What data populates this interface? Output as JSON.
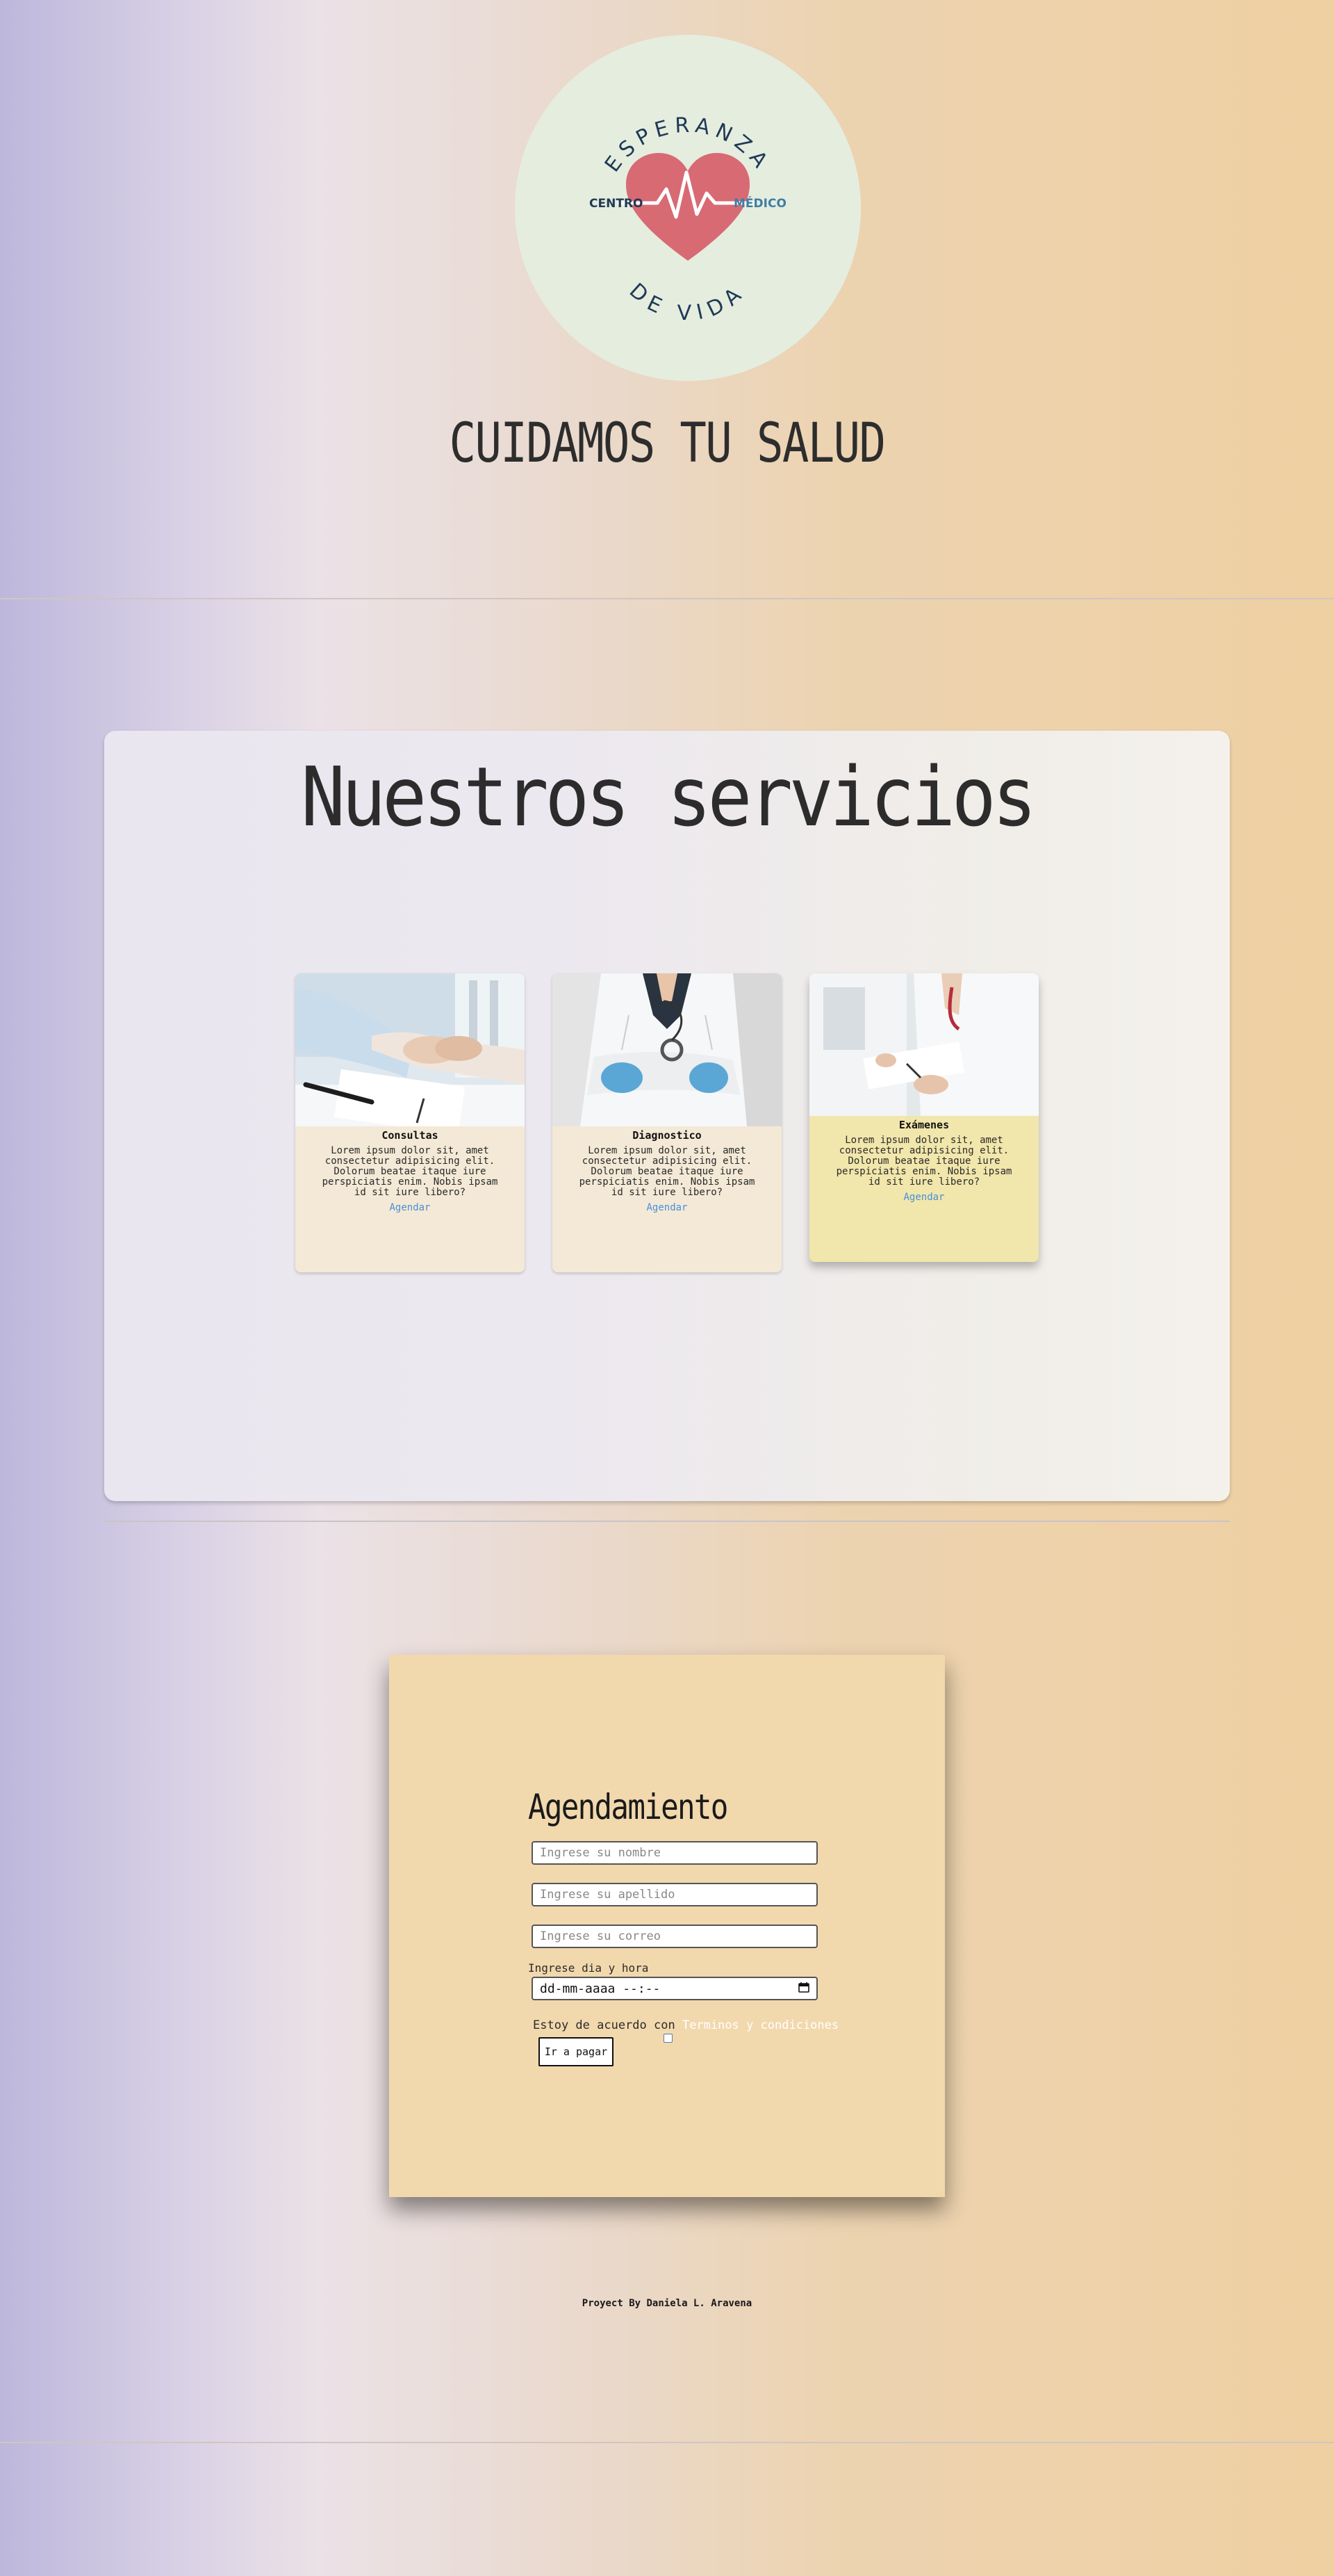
{
  "header": {
    "logo": {
      "top_text": "ESPERANZA",
      "left_text": "CENTRO",
      "right_text": "MÉDICO",
      "bottom_text": "DE VIDA",
      "colors": {
        "circle": "#e5eddf",
        "heart": "#d86a73",
        "text": "#1f3a55",
        "accent": "#3e7ea3"
      }
    },
    "title": "CUIDAMOS TU SALUD"
  },
  "services": {
    "title": "Nuestros servicios",
    "cards": [
      {
        "title": "Consultas",
        "text": "Lorem ipsum dolor sit, amet consectetur adipisicing elit. Dolorum beatae itaque iure perspiciatis enim. Nobis ipsam id sit iure libero?",
        "link": "Agendar",
        "image": "doctor-holding-patient-hands-photo"
      },
      {
        "title": "Diagnostico",
        "text": "Lorem ipsum dolor sit, amet consectetur adipisicing elit. Dolorum beatae itaque iure perspiciatis enim. Nobis ipsam id sit iure libero?",
        "link": "Agendar",
        "image": "doctor-with-stethoscope-photo"
      },
      {
        "title": "Exámenes",
        "text": "Lorem ipsum dolor sit, amet consectetur adipisicing elit. Dolorum beatae itaque iure perspiciatis enim. Nobis ipsam id sit iure libero?",
        "link": "Agendar",
        "image": "doctor-writing-clipboard-photo"
      }
    ]
  },
  "booking": {
    "title": "Agendamiento",
    "name_placeholder": "Ingrese su nombre",
    "lastname_placeholder": "Ingrese su apellido",
    "email_placeholder": "Ingrese su correo",
    "date_label": "Ingrese dia y hora",
    "date_value": "dd-mm-aaaa --:--",
    "agree_text": "Estoy de acuerdo con",
    "agree_link": "Terminos y condiciones",
    "submit_label": "Ir a pagar"
  },
  "footer": {
    "credit": "Proyect By Daniela L. Aravena"
  },
  "colors": {
    "card_bg": "#f3e9d6",
    "card_hover_bg": "#f1e6ab",
    "booking_bg": "#f2d8ad",
    "link": "#4a8fd8"
  }
}
